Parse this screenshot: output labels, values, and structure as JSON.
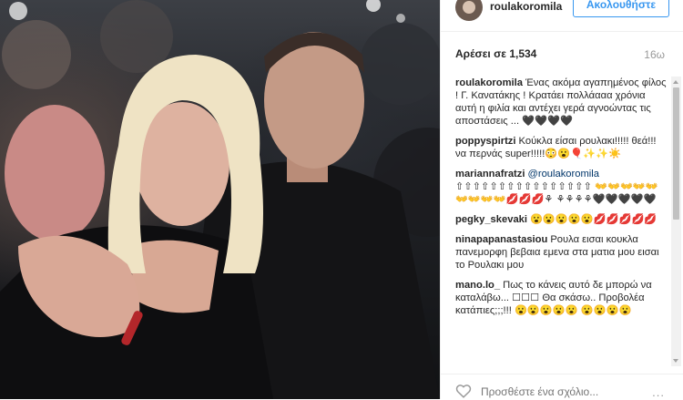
{
  "header": {
    "username": "roulakoromila",
    "follow_label": "Ακολουθήστε"
  },
  "stats": {
    "likes_label": "Αρέσει σε 1,534",
    "time_ago": "16ω"
  },
  "comments": [
    {
      "user": "roulakoromila",
      "text": "Ένας ακόμα αγαπημένος φίλος ! Γ. Κανατάκης ! Κρατάει πολλάααα χρόνια αυτή η φιλία και αντέχει γερά αγνοώντας τις αποστάσεις ... 🖤🖤🖤🖤"
    },
    {
      "user": "poppyspirtzi",
      "text": "Κούκλα είσαι ρουλακι!!!!! θεά!!!να περνάς super!!!!!😳😮🎈✨✨☀️"
    },
    {
      "user": "mariannafratzi",
      "mention": "@roulakoromila",
      "text": "⇧⇧⇧⇧⇧⇧⇧⇧⇧⇧⇧⇧⇧⇧⇧⇧ 👐👐👐👐👐👐👐👐👐💋💋💋⚘ ⚘⚘⚘⚘🖤🖤🖤🖤🖤"
    },
    {
      "user": "pegky_skevaki",
      "text": "😮😮😮😮😮💋💋💋💋💋"
    },
    {
      "user": "ninapapanastasiou",
      "text": "Ρουλα εισαι κουκλα πανεμορφη βεβαια εμενα στα ματια μου εισαι το Ρουλακι μου"
    },
    {
      "user": "mano.lo_",
      "text": "Πως το κάνεις αυτό δε μπορώ να καταλάβω... ☐☐☐ Θα σκάσω.. Προβολέα κατάπιες;;;!!! 😮😮😮😮😮 😮😮😮😮"
    }
  ],
  "footer": {
    "comment_placeholder": "Προσθέστε ένα σχόλιο...",
    "more_label": "..."
  },
  "colors": {
    "accent": "#3897f0",
    "mention": "#003569"
  },
  "icons": {
    "like": "heart-outline-icon",
    "more": "more-options-icon"
  }
}
